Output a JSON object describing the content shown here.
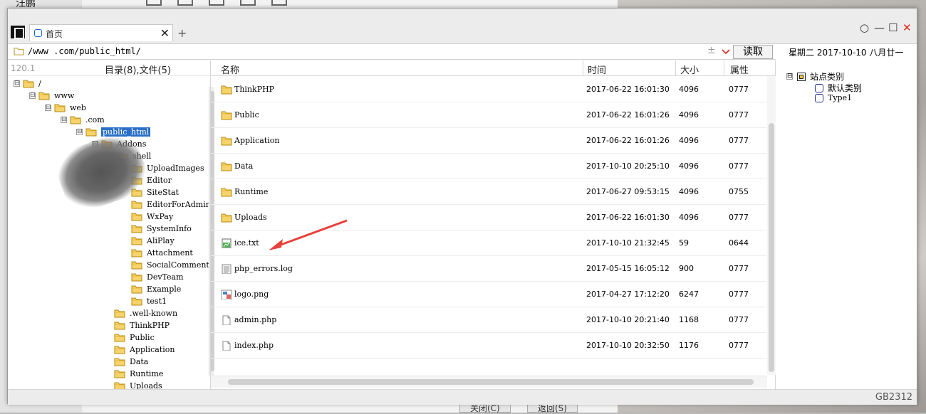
{
  "background": {
    "user_name": "汪鹏",
    "bottom_buttons": [
      "关闭(C)",
      "返回(S)"
    ]
  },
  "window": {
    "tab_title": "首页",
    "tab_close": "✕",
    "tab_add": "+",
    "controls": {
      "restore": "○",
      "minimize": "—",
      "maximize": "☐",
      "close": "✕",
      "close_color": "#d9261c"
    },
    "address": {
      "path": "/www          .com/public_html/",
      "read_button": "读取",
      "dropdown_color": "#d9261c"
    },
    "date_label": "星期二  2017-10-10  八月廿一",
    "encoding": "GB2312"
  },
  "tree": {
    "ip_hint": "120.1",
    "count_label": "目录(8),文件(5)",
    "nodes": [
      {
        "label": "/",
        "exp": "⊟"
      },
      {
        "label": "www",
        "exp": "⊟"
      },
      {
        "label": "web",
        "exp": "⊟"
      },
      {
        "label": ".com",
        "exp": "⊟"
      },
      {
        "label": "public_html",
        "exp": "⊟",
        "selected": true
      },
      {
        "label": "Addons",
        "exp": "⊟"
      },
      {
        "label": "shell",
        "exp": "⊞"
      },
      {
        "label": "UploadImages"
      },
      {
        "label": "Editor"
      },
      {
        "label": "SiteStat"
      },
      {
        "label": "EditorForAdmin"
      },
      {
        "label": "WxPay"
      },
      {
        "label": "SystemInfo"
      },
      {
        "label": "AliPlay"
      },
      {
        "label": "Attachment"
      },
      {
        "label": "SocialComment"
      },
      {
        "label": "DevTeam"
      },
      {
        "label": "Example"
      },
      {
        "label": "test1"
      },
      {
        "label": ".well-known"
      },
      {
        "label": "ThinkPHP"
      },
      {
        "label": "Public"
      },
      {
        "label": "Application"
      },
      {
        "label": "Data"
      },
      {
        "label": "Runtime"
      },
      {
        "label": "Uploads"
      }
    ]
  },
  "filelist": {
    "columns": {
      "name": "名称",
      "time": "时间",
      "size": "大小",
      "attr": "属性"
    },
    "rows": [
      {
        "name": "ThinkPHP",
        "time": "2017-06-22 16:01:30",
        "size": "4096",
        "attr": "0777",
        "icon": "folder-icon"
      },
      {
        "name": "Public",
        "time": "2017-06-22 16:01:26",
        "size": "4096",
        "attr": "0777",
        "icon": "folder-icon"
      },
      {
        "name": "Application",
        "time": "2017-06-22 16:01:26",
        "size": "4096",
        "attr": "0777",
        "icon": "folder-icon"
      },
      {
        "name": "Data",
        "time": "2017-10-10 20:25:10",
        "size": "4096",
        "attr": "0777",
        "icon": "folder-icon"
      },
      {
        "name": "Runtime",
        "time": "2017-06-27 09:53:15",
        "size": "4096",
        "attr": "0755",
        "icon": "folder-icon"
      },
      {
        "name": "Uploads",
        "time": "2017-06-22 16:01:30",
        "size": "4096",
        "attr": "0777",
        "icon": "folder-icon"
      },
      {
        "name": "ice.txt",
        "time": "2017-10-10 21:32:45",
        "size": "59",
        "attr": "0644",
        "icon": "text-file-icon"
      },
      {
        "name": "php_errors.log",
        "time": "2017-05-15 16:05:12",
        "size": "900",
        "attr": "0777",
        "icon": "log-file-icon"
      },
      {
        "name": "logo.png",
        "time": "2017-04-27 17:12:20",
        "size": "6247",
        "attr": "0777",
        "icon": "image-file-icon"
      },
      {
        "name": "admin.php",
        "time": "2017-10-10 20:21:40",
        "size": "1168",
        "attr": "0777",
        "icon": "blank-file-icon"
      },
      {
        "name": "index.php",
        "time": "2017-10-10 20:32:50",
        "size": "1176",
        "attr": "0777",
        "icon": "blank-file-icon"
      }
    ],
    "annotation_arrow_color": "#e8403a"
  },
  "sites": {
    "root": {
      "label": "站点类别",
      "exp": "⊟"
    },
    "items": [
      {
        "label": "默认类别"
      },
      {
        "label": "Type1"
      }
    ]
  }
}
